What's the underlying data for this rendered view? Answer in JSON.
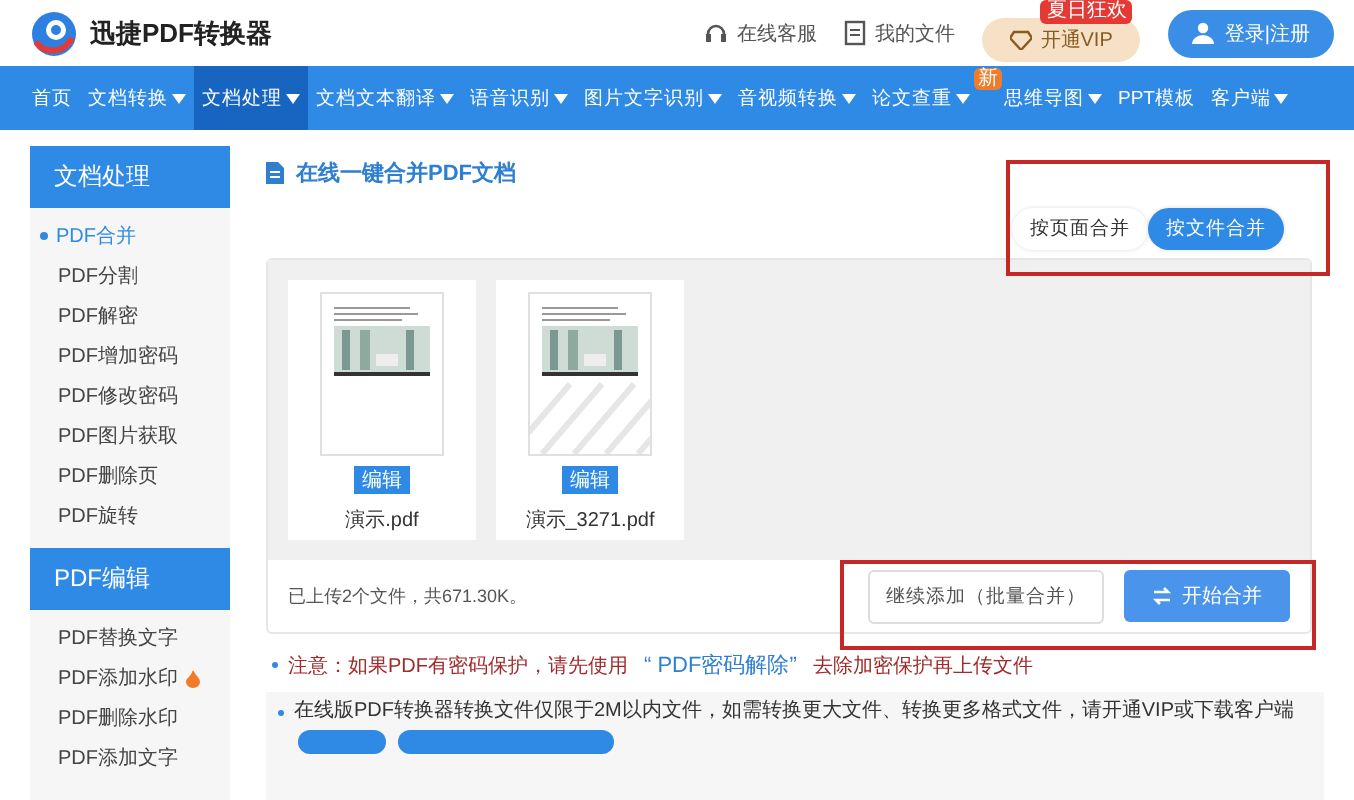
{
  "header": {
    "logo_text": "迅捷PDF转换器",
    "links": [
      {
        "kind": "headset",
        "label": "在线客服"
      },
      {
        "kind": "file",
        "label": "我的文件"
      }
    ],
    "vip": {
      "label": "开通VIP",
      "badge": "夏日狂欢"
    },
    "login": {
      "label": "登录|注册"
    }
  },
  "nav": [
    {
      "label": "首页",
      "has_menu": false,
      "selected": false
    },
    {
      "label": "文档转换",
      "has_menu": true,
      "selected": false
    },
    {
      "label": "文档处理",
      "has_menu": true,
      "selected": true
    },
    {
      "label": "文档文本翻译",
      "has_menu": true,
      "selected": false
    },
    {
      "label": "语音识别",
      "has_menu": true,
      "selected": false
    },
    {
      "label": "图片文字识别",
      "has_menu": true,
      "selected": false
    },
    {
      "label": "音视频转换",
      "has_menu": true,
      "selected": false
    },
    {
      "label": "论文查重",
      "has_menu": true,
      "selected": false,
      "badge": "新"
    },
    {
      "label": "思维导图",
      "has_menu": true,
      "selected": false
    },
    {
      "label": "PPT模板",
      "has_menu": false,
      "selected": false
    },
    {
      "label": "客户端",
      "has_menu": true,
      "selected": false
    }
  ],
  "sidebar": [
    {
      "title": "文档处理",
      "items": [
        {
          "label": "PDF合并",
          "selected": true,
          "hot": false
        },
        {
          "label": "PDF分割",
          "selected": false,
          "hot": false
        },
        {
          "label": "PDF解密",
          "selected": false,
          "hot": false
        },
        {
          "label": "PDF增加密码",
          "selected": false,
          "hot": false
        },
        {
          "label": "PDF修改密码",
          "selected": false,
          "hot": false
        },
        {
          "label": "PDF图片获取",
          "selected": false,
          "hot": false
        },
        {
          "label": "PDF删除页",
          "selected": false,
          "hot": false
        },
        {
          "label": "PDF旋转",
          "selected": false,
          "hot": false
        }
      ]
    },
    {
      "title": "PDF编辑",
      "items": [
        {
          "label": "PDF替换文字",
          "selected": false,
          "hot": false
        },
        {
          "label": "PDF添加水印",
          "selected": false,
          "hot": true
        },
        {
          "label": "PDF删除水印",
          "selected": false,
          "hot": false
        },
        {
          "label": "PDF添加文字",
          "selected": false,
          "hot": false
        }
      ]
    }
  ],
  "main": {
    "title": "在线一键合并PDF文档",
    "merge_modes": [
      {
        "label": "按页面合并",
        "selected": false
      },
      {
        "label": "按文件合并",
        "selected": true
      }
    ],
    "files": [
      {
        "name": "演示.pdf",
        "edit_label": "编辑",
        "watermarked": false
      },
      {
        "name": "演示_3271.pdf",
        "edit_label": "编辑",
        "watermarked": true
      }
    ],
    "summary": "已上传2个文件，共671.30K。",
    "add_button": "继续添加（批量合并）",
    "start_button": "开始合并",
    "notice": {
      "before": "注意：如果PDF有密码保护，请先使用",
      "link": "“ PDF密码解除”",
      "after": "去除加密保护再上传文件"
    },
    "info": "在线版PDF转换器转换文件仅限于2M以内文件，如需转换更大文件、转换更多格式文件，请开通VIP或下载客户端"
  }
}
